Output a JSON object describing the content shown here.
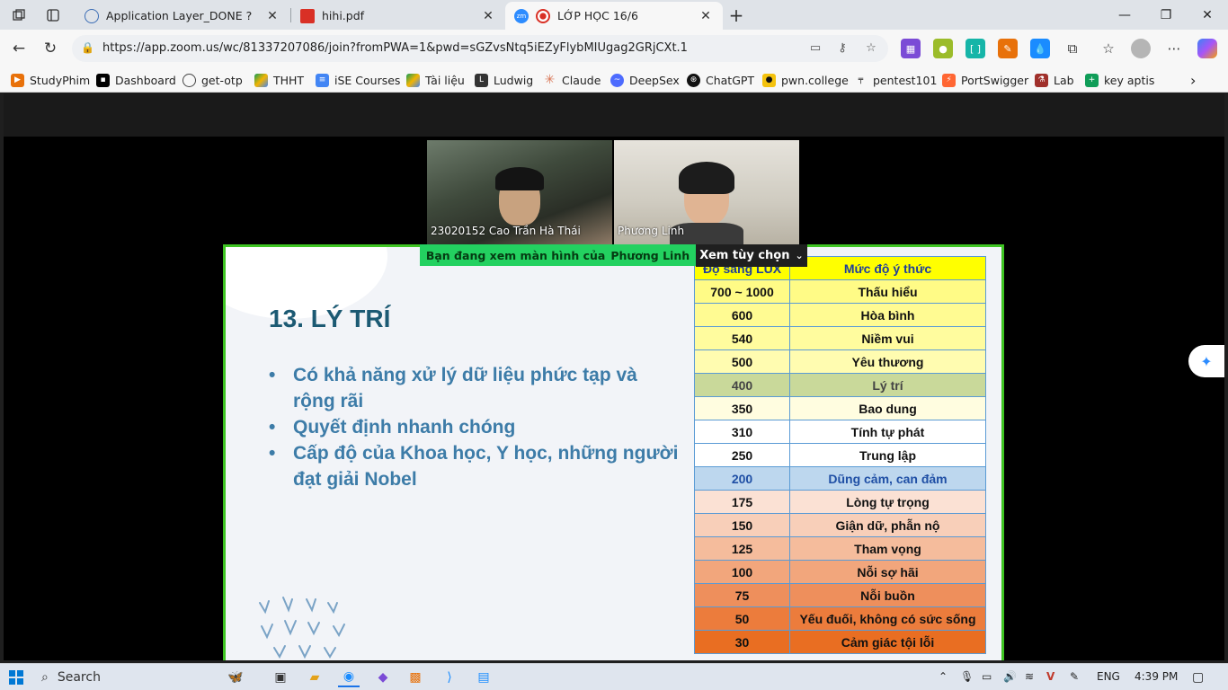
{
  "browser": {
    "tabs": [
      {
        "title": "Application Layer_DONE ?",
        "active": false
      },
      {
        "title": "hihi.pdf",
        "active": false
      },
      {
        "title": "LỚP HỌC 16/6",
        "active": true
      }
    ],
    "url": "https://app.zoom.us/wc/81337207086/join?fromPWA=1&pwd=sGZvsNtq5iEZyFlybMIUgag2GRjCXt.1",
    "bookmarks": [
      {
        "label": "StudyPhim",
        "color": "#e8710a"
      },
      {
        "label": "Dashboard",
        "color": "#000000"
      },
      {
        "label": "get-otp",
        "color": "#5f6368"
      },
      {
        "label": "THHT",
        "color": "#1a73e8"
      },
      {
        "label": "iSE Courses",
        "color": "#4285f4"
      },
      {
        "label": "Tài liệu",
        "color": "#0f9d58"
      },
      {
        "label": "Ludwig",
        "color": "#333333"
      },
      {
        "label": "Claude",
        "color": "#d97757"
      },
      {
        "label": "DeepSex",
        "color": "#4d6bfe"
      },
      {
        "label": "ChatGPT",
        "color": "#111111"
      },
      {
        "label": "pwn.college",
        "color": "#f4c20d"
      },
      {
        "label": "pentest101",
        "color": "#222222"
      },
      {
        "label": "PortSwigger",
        "color": "#ff6633"
      },
      {
        "label": "Lab",
        "color": "#a0302b"
      },
      {
        "label": "key aptis",
        "color": "#0f9d58"
      }
    ]
  },
  "zoom": {
    "participants": [
      {
        "name": "23020152 Cao Trần Hà Thái"
      },
      {
        "name": "Phương Linh"
      }
    ],
    "share_banner": {
      "text": "Bạn đang xem màn hình của",
      "presenter": "Phương Linh"
    },
    "view_options_label": "Xem tùy chọn"
  },
  "slide": {
    "title": "13. LÝ TRÍ",
    "bullets": [
      "Có khả năng xử lý dữ liệu phức tạp và rộng rãi",
      "Quyết định nhanh chóng",
      "Cấp độ của Khoa học, Y học, những người đạt giải Nobel"
    ],
    "table": {
      "headers": [
        "Độ sáng LUX",
        "Mức độ ý thức"
      ],
      "rows": [
        {
          "lux": "700 ~ 1000",
          "level": "Thấu hiểu",
          "bg": "#fffb86",
          "fg": "#111111"
        },
        {
          "lux": "600",
          "level": "Hòa bình",
          "bg": "#fffb92",
          "fg": "#111111"
        },
        {
          "lux": "540",
          "level": "Niềm vui",
          "bg": "#fffc9e",
          "fg": "#111111"
        },
        {
          "lux": "500",
          "level": "Yêu thương",
          "bg": "#fffcb0",
          "fg": "#111111"
        },
        {
          "lux": "400",
          "level": "Lý trí",
          "bg": "#c9d99a",
          "fg": "#444444"
        },
        {
          "lux": "350",
          "level": "Bao dung",
          "bg": "#fffde0",
          "fg": "#111111"
        },
        {
          "lux": "310",
          "level": "Tính tự phát",
          "bg": "#ffffff",
          "fg": "#111111"
        },
        {
          "lux": "250",
          "level": "Trung lập",
          "bg": "#ffffff",
          "fg": "#111111"
        },
        {
          "lux": "200",
          "level": "Dũng cảm, can đảm",
          "bg": "#bdd7ee",
          "fg": "#1f4fa5"
        },
        {
          "lux": "175",
          "level": "Lòng tự trọng",
          "bg": "#fbe1d4",
          "fg": "#111111"
        },
        {
          "lux": "150",
          "level": "Giận dữ, phẫn nộ",
          "bg": "#f8cfb9",
          "fg": "#111111"
        },
        {
          "lux": "125",
          "level": "Tham vọng",
          "bg": "#f5bc9c",
          "fg": "#111111"
        },
        {
          "lux": "100",
          "level": "Nỗi sợ hãi",
          "bg": "#f2a67c",
          "fg": "#111111"
        },
        {
          "lux": "75",
          "level": "Nỗi buồn",
          "bg": "#ee8f5c",
          "fg": "#111111"
        },
        {
          "lux": "50",
          "level": "Yếu đuối, không có sức sống",
          "bg": "#ec7c3c",
          "fg": "#111111"
        },
        {
          "lux": "30",
          "level": "Cảm giác tội lỗi",
          "bg": "#e96e22",
          "fg": "#111111"
        }
      ],
      "header_bg": "#ffff00",
      "header_fg": "#1f3f9a"
    }
  },
  "taskbar": {
    "search_label": "Search",
    "language": "ENG",
    "time": "4:39 PM"
  }
}
